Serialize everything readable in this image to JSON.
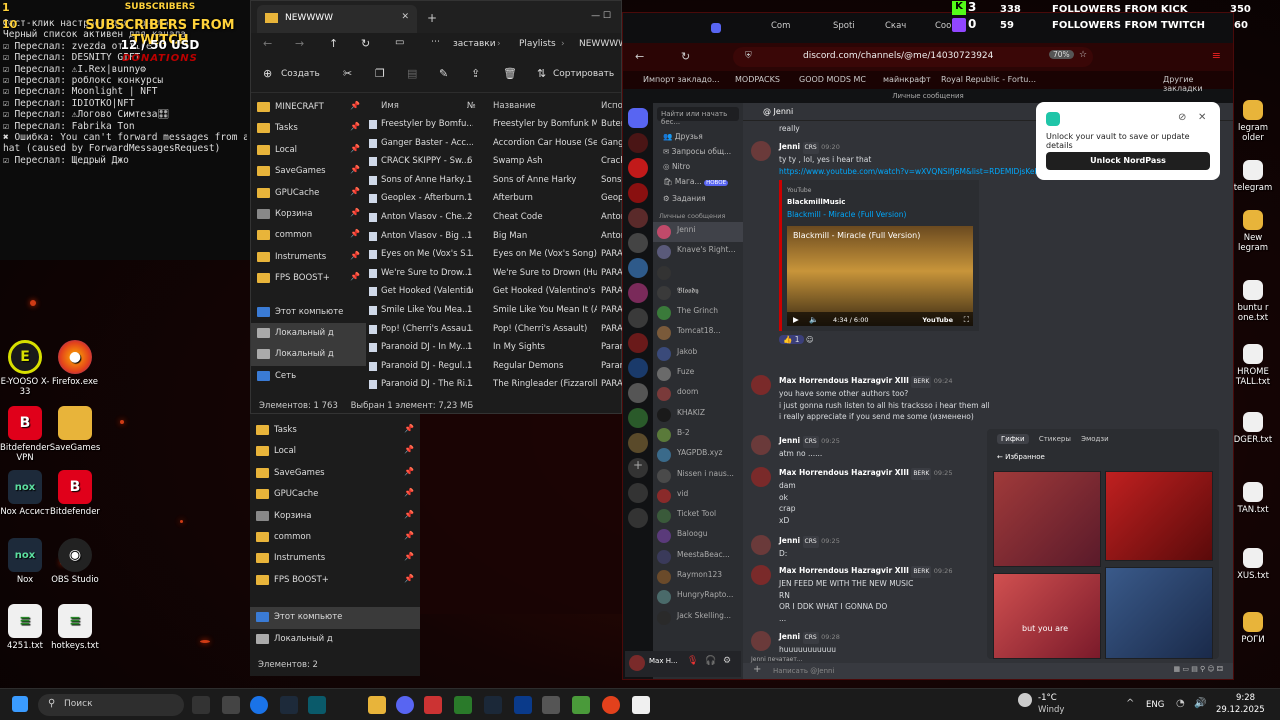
{
  "overlay_left": {
    "nums": [
      "1",
      "10"
    ],
    "subscribers_title": "SUBSCRIBERS",
    "subscribers_from": "SUBSCRIBERS FROM TWITCH",
    "money": "12 / 50 USD",
    "donations": "DONATIONS"
  },
  "console": {
    "lines": [
      "Фаст-клик настроен для канала",
      "Черный список активен для канала",
      "☑ Переслал: zvezda от fire",
      "☑ Переслал: DESNITY GIFT",
      "☑ Переслал: ⚠I.Rex|вunny⚙",
      "☑ Переслал: роблокс конкурсы",
      "☑ Переслал: Moonlight | NFT",
      "☑ Переслал: IDIOTKO|NFT",
      "☑ Переслал: ⚠Логово Симтеза🎛",
      "☑ Переслал: Fabrika Ton",
      "✖ Ошибка: You can't forward messages from a p",
      "hat (caused by ForwardMessagesRequest)",
      "☑ Переслал: Щедрый Джо"
    ]
  },
  "desktop_icons": [
    {
      "label": "E-YOOSO X-33",
      "glyph": "E"
    },
    {
      "label": "Firefox.exe",
      "glyph": "●"
    },
    {
      "label": "Bitdefender VPN",
      "glyph": "B"
    },
    {
      "label": "SaveGames",
      "glyph": ""
    },
    {
      "label": "Nox Ассист",
      "glyph": "nox"
    },
    {
      "label": "Bitdefender",
      "glyph": "B"
    },
    {
      "label": "Nox",
      "glyph": "nox"
    },
    {
      "label": "OBS Studio",
      "glyph": "◉"
    },
    {
      "label": "4251.txt",
      "glyph": "≡"
    },
    {
      "label": "hotkeys.txt",
      "glyph": "≡"
    }
  ],
  "explorer": {
    "tab_title": "NEWWWW",
    "breadcrumb": [
      "заставки",
      "Playlists",
      "NEWWWW"
    ],
    "create": "Создать",
    "sort": "Сортировать",
    "sidebar": [
      "MINECRAFT",
      "Tasks",
      "Local",
      "SaveGames",
      "GPUCache",
      "Корзина",
      "common",
      "Instruments",
      "FPS BOOST+"
    ],
    "tree": [
      "Этот компьюте",
      "Локальный д",
      "Локальный д",
      "Сеть"
    ],
    "columns": [
      "Имя",
      "№",
      "Название",
      "Испо"
    ],
    "rows": [
      [
        "Freestyler by Bomfu...",
        "",
        "Freestyler by Bomfunk M...",
        "Buten"
      ],
      [
        "Ganger Baster - Acc...",
        "",
        "Accordion Car House (Sef...",
        "Gange"
      ],
      [
        "CRACK SKIPPY - Sw...",
        "6",
        "Swamp Ash",
        "Crack"
      ],
      [
        "Sons of Anne Harky...",
        "1",
        "Sons of Anne Harky",
        "Sons"
      ],
      [
        "Geoplex - Afterburn...",
        "1",
        "Afterburn",
        "Geopl"
      ],
      [
        "Anton Vlasov - Che...",
        "2",
        "Cheat Code",
        "Anton"
      ],
      [
        "Anton Vlasov - Big ...",
        "1",
        "Big Man",
        "Anton"
      ],
      [
        "Eyes on Me (Vox's S...",
        "1",
        "Eyes on Me (Vox's Song)",
        "PARAN"
      ],
      [
        "We're Sure to Drow...",
        "1",
        "We're Sure to Drown (Hus...",
        "PARAN"
      ],
      [
        "Get Hooked (Valentino's ...",
        "1",
        "Get Hooked (Valentino's ...",
        "PARAN"
      ],
      [
        "Smile Like You Mea...",
        "1",
        "Smile Like You Mean It (Al...",
        "PARAN"
      ],
      [
        "Pop! (Cherri's Assau...",
        "1",
        "Pop! (Cherri's Assault)",
        "PARAN"
      ],
      [
        "Paranoid DJ - In My...",
        "1",
        "In My Sights",
        "Paran"
      ],
      [
        "Paranoid DJ - Regul...",
        "1",
        "Regular Demons",
        "Paran"
      ],
      [
        "Paranoid DJ - The Ri...",
        "1",
        "The Ringleader (Fizzarolli'...",
        "PARAN"
      ]
    ],
    "status_count": "Элементов: 1 763",
    "status_selected": "Выбран 1 элемент: 7,23 МБ"
  },
  "explorer2": {
    "sidebar": [
      "Tasks",
      "Local",
      "SaveGames",
      "GPUCache",
      "Корзина",
      "common",
      "Instruments",
      "FPS BOOST+"
    ],
    "tree": [
      "Этот компьюте",
      "Локальный д"
    ],
    "status": "Элементов: 2"
  },
  "browser": {
    "tabs": [
      "Com",
      "Spoti",
      "Скач",
      "Coo"
    ],
    "url": "discord.com/channels/@me/14030723924",
    "zoom": "70%",
    "bookmarks": [
      "Импорт закладо...",
      "MODPACKS",
      "GOOD MODS MC",
      "майнкрафт",
      "Royal Republic - Fortu...",
      "Другие закладки"
    ]
  },
  "discord": {
    "top_label": "Личные сообщения",
    "search": "Найти или начать бес...",
    "nav": [
      "Друзья",
      "Запросы общ...",
      "Nitro",
      "Мага...",
      "Задания"
    ],
    "new_badge": "НОВОЕ",
    "dm_header": "Личные сообщения",
    "dms": [
      "Jenni",
      "Knave's Right...",
      "",
      "𝕭𝖑𝖔𝖔𝖉𝖞",
      "The Grinch",
      "Tomcat18...",
      "Jakob",
      "Fuze",
      "doom",
      "KHAKIZ",
      "B-2",
      "YAGPDB.xyz",
      "Nissen i naus...",
      "vid",
      "Ticket Tool",
      "Baloogu",
      "MeestaBeac...",
      "Raymon123",
      "HungryRapto...",
      "Jack Skelling..."
    ],
    "channel_name": "Jenni",
    "input_placeholder": "Написать @Jenni",
    "user_name": "Max H...",
    "messages": [
      {
        "name": "",
        "tag": "",
        "time": "",
        "lines": [
          "really"
        ]
      },
      {
        "name": "Jenni",
        "tag": "CRS",
        "time": "09:20",
        "lines": [
          "ty ty , lol, yes i hear that",
          "https://www.youtube.com/watch?v=wXVQNSIfJ6M&list=RDEMIDjsKeITKwrK5aR4NE"
        ]
      },
      {
        "name": "Max Horrendous Hazragvir XIII",
        "tag": "BERK",
        "time": "09:24",
        "lines": [
          "you have some other authors too?",
          "i just gonna rush listen to all his tracksso i hear them all",
          "i really appreciate if you send me some (изменено)"
        ]
      },
      {
        "name": "Jenni",
        "tag": "CRS",
        "time": "09:25",
        "lines": [
          "atm no ......"
        ]
      },
      {
        "name": "Max Horrendous Hazragvir XIII",
        "tag": "BERK",
        "time": "09:25",
        "lines": [
          "dam",
          "ok",
          "crap",
          "xD"
        ]
      },
      {
        "name": "Jenni",
        "tag": "CRS",
        "time": "09:25",
        "lines": [
          "D:"
        ]
      },
      {
        "name": "Max Horrendous Hazragvir XIII",
        "tag": "BERK",
        "time": "09:26",
        "lines": [
          "JEN FEED ME WITH THE NEW MUSIC",
          "RN",
          "OR I DDK WHAT I GONNA DO",
          "..."
        ]
      },
      {
        "name": "Jenni",
        "tag": "CRS",
        "time": "09:28",
        "lines": [
          "huuuuuuuuuuu"
        ]
      }
    ],
    "embed": {
      "site": "YouTube",
      "author": "BlackmillMusic",
      "title": "Blackmill - Miracle (Full Version)",
      "time": "4:34 / 6:00",
      "yt": "YouTube"
    },
    "gif_tabs": [
      "Гифки",
      "Стикеры",
      "Эмодзи"
    ],
    "gif_favorites": "Избранное",
    "gif_caption": "but you are",
    "typing": "Jenni печатает..."
  },
  "nordpass": {
    "message": "Unlock your vault to save or update details",
    "button": "Unlock NordPass"
  },
  "overlay_right": {
    "kick_count": "3",
    "kick_followers": "338",
    "kick_label": "FOLLOWERS FROM KICK",
    "kick_goal": "350",
    "twitch_count": "0",
    "twitch_followers": "59",
    "twitch_label": "FOLLOWERS FROM TWITCH",
    "twitch_goal": "60"
  },
  "desktop_right_icons": [
    "legram older",
    "telegram",
    "New legram",
    "buntu r one.txt",
    "HROME TALL.txt",
    "DGER.txt",
    "TAN.txt",
    "XUS.txt",
    "РОГИ"
  ],
  "taskbar": {
    "search": "Поиск",
    "weather_temp": "-1°C",
    "weather_desc": "Windy",
    "lang": "ENG",
    "time": "9:28",
    "date": "29.12.2025"
  }
}
